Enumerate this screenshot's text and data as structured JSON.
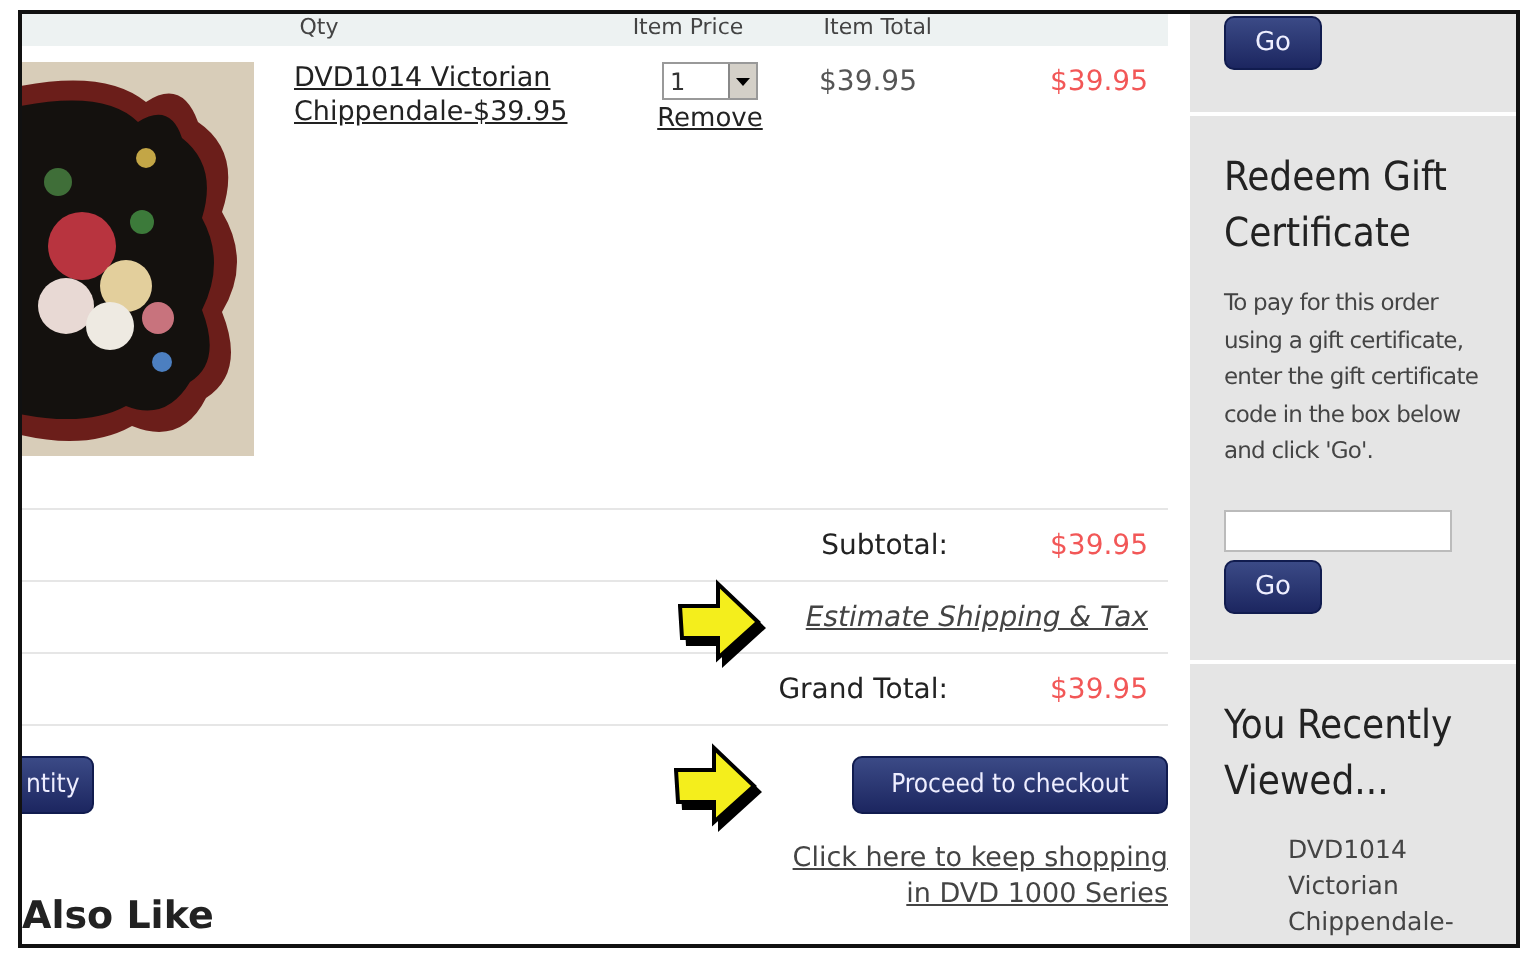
{
  "cart": {
    "columns": [
      "Qty",
      "Item Price",
      "Item Total"
    ],
    "items": [
      {
        "name": "DVD1014 Victorian Chippendale-$39.95",
        "quantity": "1",
        "remove": "Remove",
        "price": "$39.95",
        "total": "$39.95"
      }
    ],
    "subtotal": {
      "label": "Subtotal:",
      "value": "$39.95"
    },
    "estimate_link": "Estimate Shipping & Tax",
    "grand_total": {
      "label": "Grand Total:",
      "value": "$39.95"
    },
    "update_button": "ntity",
    "checkout_button": "Proceed to checkout",
    "keep_shopping_link": "Click here to keep shopping in DVD 1000 Series"
  },
  "related_heading": "Also Like",
  "sidebar": {
    "top_button": "Go",
    "gift": {
      "title": "Redeem Gift Certificate",
      "text": "To pay for this order using a gift certificate, enter the gift certificate code in the box below and click 'Go'.",
      "button": "Go"
    },
    "recent": {
      "title": "You Recently Viewed...",
      "items": [
        "DVD1014 Victorian Chippendale-"
      ]
    }
  }
}
